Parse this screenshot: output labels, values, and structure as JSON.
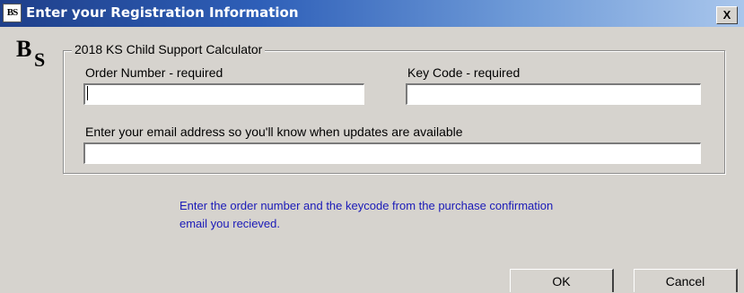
{
  "window": {
    "title": "Enter your Registration Information",
    "icon_text": "BS",
    "close_label": "X"
  },
  "logo": {
    "letter_1": "B",
    "letter_2": "S"
  },
  "group": {
    "label": "2018 KS Child Support Calculator",
    "order_label": "Order Number - required",
    "order_value": "",
    "keycode_label": "Key Code - required",
    "keycode_value": "",
    "email_label": "Enter your email address so you'll know when updates are available",
    "email_value": ""
  },
  "info": {
    "line1": "Enter the order number and the keycode from the purchase confirmation",
    "line2": "email you recieved."
  },
  "buttons": {
    "ok": "OK",
    "cancel": "Cancel"
  },
  "colors": {
    "title_gradient_start": "#1f3f8a",
    "info_text": "#1a1ab8",
    "dialog_bg": "#d6d3ce"
  }
}
